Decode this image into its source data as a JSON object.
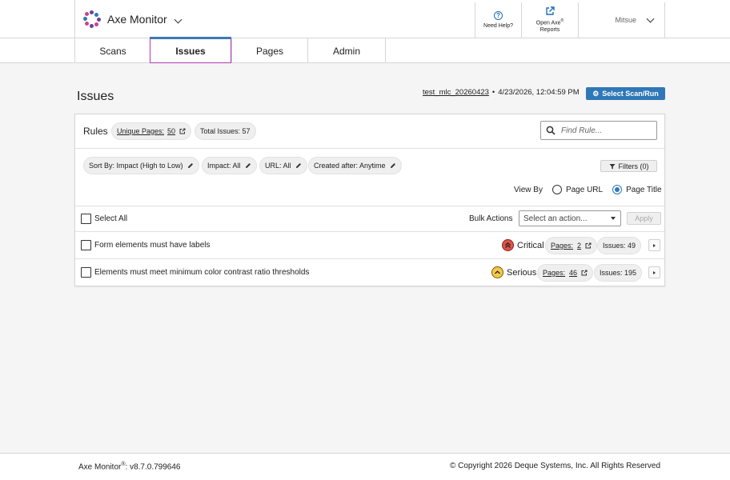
{
  "header": {
    "app_name": "Axe Monitor",
    "help_label": "Need Help?",
    "reports_label_line1": "Open Axe",
    "reports_label_reg": "®",
    "reports_label_line2": "Reports",
    "user_name": "Mitsue"
  },
  "tabs": [
    {
      "label": "Scans",
      "active": false
    },
    {
      "label": "Issues",
      "active": true
    },
    {
      "label": "Pages",
      "active": false
    },
    {
      "label": "Admin",
      "active": false
    }
  ],
  "page": {
    "title": "Issues",
    "scan_name": "test_mlc_20260423",
    "scan_separator": "•",
    "scan_datetime": "4/23/2026, 12:04:59 PM",
    "select_scan_label": "Select Scan/Run"
  },
  "rules_panel": {
    "label": "Rules",
    "unique_pages_label": "Unique Pages:",
    "unique_pages_value": "50",
    "total_issues_label": "Total Issues: 57",
    "search_placeholder": "Find Rule...",
    "chips": {
      "sort": "Sort By: Impact (High to Low)",
      "impact": "Impact: All",
      "url": "URL: All",
      "created": "Created after: Anytime"
    },
    "filters_label": "Filters (0)",
    "view_by_label": "View By",
    "view_by_options": [
      "Page URL",
      "Page Title"
    ],
    "view_by_selected": "Page Title",
    "select_all_label": "Select All",
    "bulk_actions_label": "Bulk Actions",
    "bulk_select_placeholder": "Select an action...",
    "apply_label": "Apply",
    "rows": [
      {
        "rule": "Form elements must have labels",
        "impact": "Critical",
        "pages_label": "Pages:",
        "pages_value": "2",
        "issues_label": "Issues: 49"
      },
      {
        "rule": "Elements must meet minimum color contrast ratio thresholds",
        "impact": "Serious",
        "pages_label": "Pages:",
        "pages_value": "46",
        "issues_label": "Issues: 195"
      }
    ]
  },
  "footer": {
    "version_prefix": "Axe Monitor",
    "version_reg": "®",
    "version": ": v8.7.0.799646",
    "copyright": "© Copyright 2026 Deque Systems, Inc. All Rights Reserved"
  },
  "colors": {
    "accent_blue": "#2f78b7",
    "active_tab_border": "#b23ab8",
    "critical": "#e0514a",
    "serious": "#f2c94c"
  },
  "icons": {
    "logo": "axe-logo-icon",
    "help": "help-circle-icon",
    "reports": "external-link-icon",
    "search": "search-icon",
    "edit": "pencil-icon",
    "filter": "filter-icon",
    "settings": "gear-icon",
    "critical": "double-chevron-up-icon",
    "serious": "chevron-up-icon",
    "expand": "caret-right-icon"
  }
}
